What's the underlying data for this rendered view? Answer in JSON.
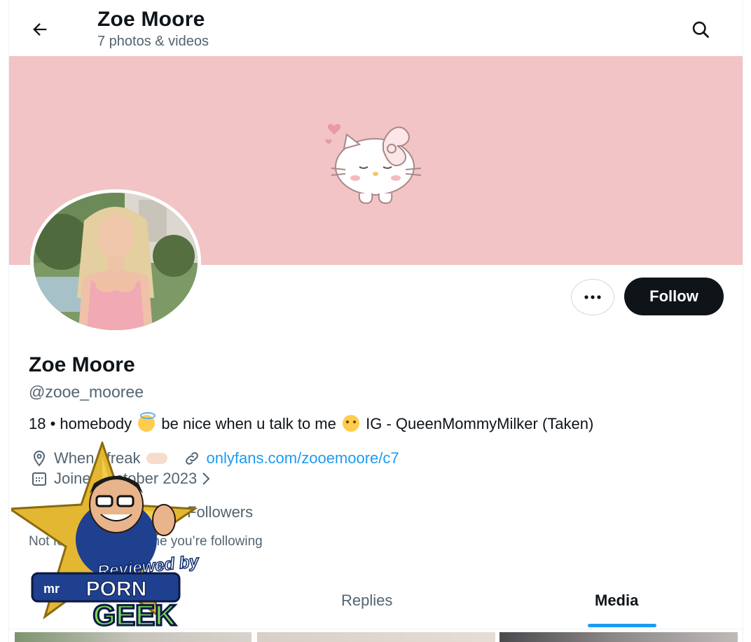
{
  "header": {
    "title": "Zoe Moore",
    "subtitle": "7 photos & videos",
    "back_icon": "arrow-left-icon",
    "search_icon": "search-icon"
  },
  "profile": {
    "name": "Zoe Moore",
    "handle": "@zooe_mooree",
    "bio_part1": "18 • homebody",
    "bio_part2": "be nice when u talk to me",
    "bio_part3": "IG - QueenMommyMilker (Taken)",
    "location": "When i freak",
    "website": "onlyfans.com/zooemoore/c7",
    "joined": "Joined October 2023",
    "followers_text": "Followers",
    "not_followed": "Not followed by anyone you’re following"
  },
  "actions": {
    "more_label": "•••",
    "follow_label": "Follow"
  },
  "tabs": {
    "replies": "Replies",
    "media": "Media"
  },
  "watermark": {
    "line1": "Reviewed by",
    "brand_mr": "mr",
    "brand_porn": "PORN",
    "brand_geek": "GEEK"
  },
  "colors": {
    "banner": "#f2c4c5",
    "accent": "#1d9bf0",
    "text": "#0f1419",
    "muted": "#536471"
  }
}
